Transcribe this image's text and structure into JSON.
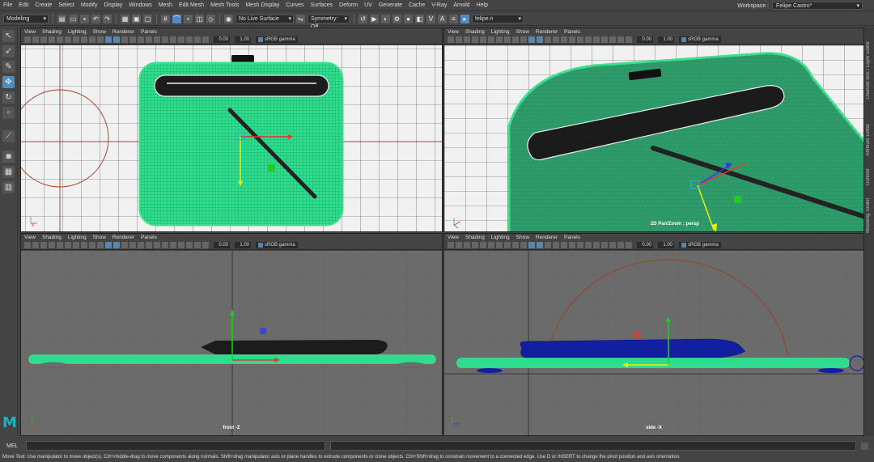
{
  "menubar": {
    "items": [
      "File",
      "Edit",
      "Create",
      "Select",
      "Modify",
      "Display",
      "Windows",
      "Mesh",
      "Edit Mesh",
      "Mesh Tools",
      "Mesh Display",
      "Curves",
      "Surfaces",
      "Deform",
      "UV",
      "Generate",
      "Cache",
      "V-Ray",
      "Arnold",
      "Help"
    ],
    "workspace_label": "Workspace :",
    "workspace_value": "Felipe Castro*"
  },
  "statusline": {
    "mode": "Modeling",
    "live_surface": "No Live Surface",
    "symmetry": "Symmetry: Off",
    "object_field": "felipe.n"
  },
  "viewport_menu": [
    "View",
    "Shading",
    "Lighting",
    "Show",
    "Renderer",
    "Panels"
  ],
  "viewports": [
    {
      "id": "top",
      "label": "",
      "field_a": "0.00",
      "field_b": "1.00",
      "colorspace": "sRGB gamma"
    },
    {
      "id": "persp",
      "label": "2D Pan/Zoom : persp",
      "field_a": "0.00",
      "field_b": "1.00",
      "colorspace": "sRGB gamma"
    },
    {
      "id": "front",
      "label": "front -Z",
      "field_a": "0.00",
      "field_b": "1.00",
      "colorspace": "sRGB gamma"
    },
    {
      "id": "side",
      "label": "side -X",
      "field_a": "0.00",
      "field_b": "1.00",
      "colorspace": "sRGB gamma"
    }
  ],
  "side_tabs": [
    "Channel Box / Layer Editor",
    "Attribute Editor",
    "Outliner",
    "Modeling Toolkit"
  ],
  "mel": {
    "label": "MEL"
  },
  "help_line": "Move Tool: Use manipulator to move object(s). Ctrl+middle-drag to move components along normals. Shift+drag manipulator axis or plane handles to extrude components or clone objects. Ctrl+Shift+drag to constrain movement to a connected edge. Use D or INSERT to change the pivot position and axis orientation.",
  "colors": {
    "selection_green": "#3fe08f",
    "wire_green": "#2fb87a",
    "axis_red": "#e33",
    "axis_green": "#2c2",
    "axis_yellow": "#ee0",
    "axis_blue": "#33f",
    "maya_teal": "#19b3c2"
  },
  "icons": [
    "select-icon",
    "lasso-icon",
    "paint-select-icon",
    "move-icon",
    "rotate-icon",
    "scale-icon",
    "show-manipulator-icon",
    "single-perspective-icon",
    "four-view-icon",
    "outliner-icon"
  ]
}
